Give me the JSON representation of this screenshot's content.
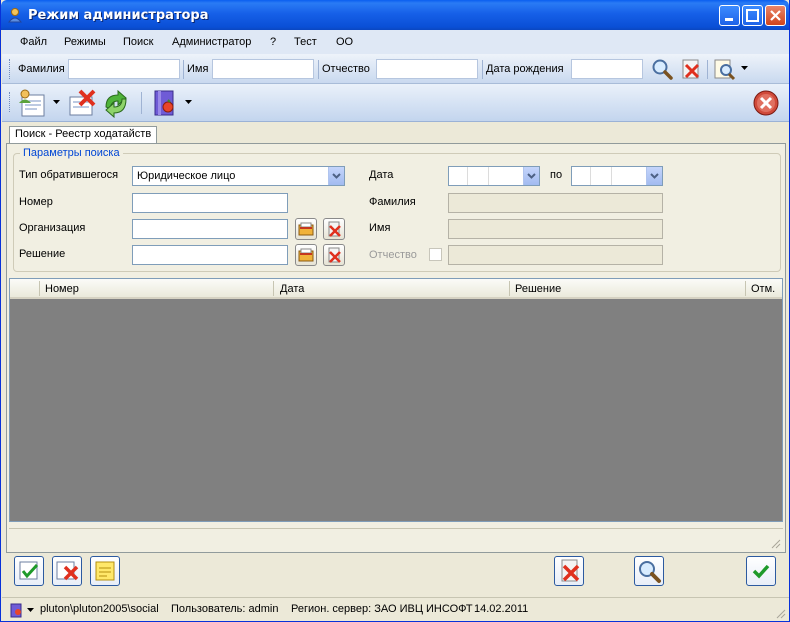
{
  "window": {
    "title": "Режим администратора"
  },
  "menu": [
    "Файл",
    "Режимы",
    "Поиск",
    "Администратор",
    "?",
    "Тест",
    "ОО"
  ],
  "quicksearch": {
    "surname_label": "Фамилия",
    "name_label": "Имя",
    "patronymic_label": "Отчество",
    "birthdate_label": "Дата рождения"
  },
  "tab": {
    "label": "Поиск - Реестр ходатайств"
  },
  "search_params": {
    "title": "Параметры поиска",
    "applicant_type_label": "Тип обратившегося",
    "applicant_type_value": "Юридическое лицо",
    "number_label": "Номер",
    "organization_label": "Организация",
    "decision_label": "Решение",
    "date_label": "Дата",
    "date_to_label": "по",
    "surname_label": "Фамилия",
    "name_label": "Имя",
    "patronymic_label": "Отчество"
  },
  "grid": {
    "columns": [
      "Номер",
      "Дата",
      "Решение",
      "Отм."
    ]
  },
  "status": {
    "path": "pluton\\pluton2005\\social",
    "user": "Пользователь: admin",
    "server": "Регион. сервер: ЗАО ИВЦ ИНСОФТ",
    "date": "14.02.2011"
  }
}
